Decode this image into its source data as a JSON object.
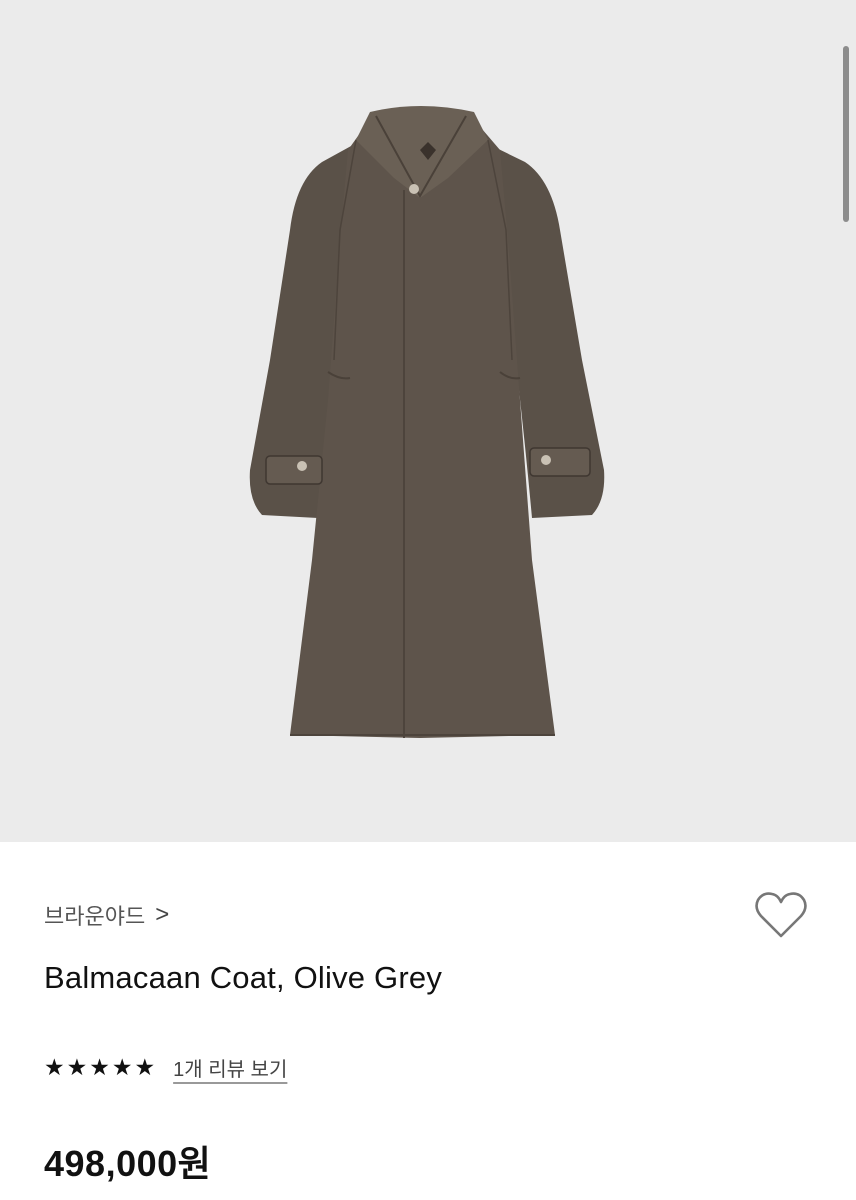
{
  "product": {
    "brand": "브라운야드",
    "brand_chevron": ">",
    "name": "Balmacaan Coat, Olive Grey",
    "rating_stars": 5,
    "review_link": "1개 리뷰 보기",
    "price": "498,000원"
  },
  "colors": {
    "hero_background": "#ebebeb",
    "coat": "#5e544b",
    "text_primary": "#111111",
    "text_secondary": "#555555"
  },
  "icons": {
    "wishlist": "heart-outline-icon",
    "star": "star-filled-icon"
  }
}
